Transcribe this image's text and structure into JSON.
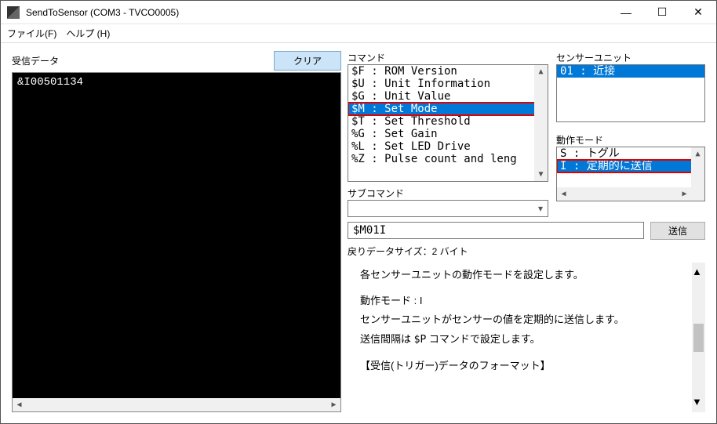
{
  "window": {
    "title": "SendToSensor (COM3 - TVCO0005)"
  },
  "menu": {
    "file": "ファイル(F)",
    "help": "ヘルプ (H)"
  },
  "left": {
    "label": "受信データ",
    "clear": "クリア",
    "console_line": "&I00501134"
  },
  "command": {
    "label": "コマンド",
    "items": [
      "$F : ROM Version",
      "$U : Unit Information",
      "$G : Unit Value",
      "$M : Set Mode",
      "$T : Set Threshold",
      "%G : Set Gain",
      "%L : Set LED Drive",
      "%Z : Pulse count and leng"
    ],
    "selected_index": 3
  },
  "sensor_unit": {
    "label": "センサーユニット",
    "item": "01 : 近接"
  },
  "mode": {
    "label": "動作モード",
    "items": [
      "S : トグル",
      "I : 定期的に送信"
    ],
    "selected_index": 1
  },
  "subcommand": {
    "label": "サブコマンド",
    "value": ""
  },
  "send": {
    "value": "$M01I",
    "button": "送信"
  },
  "return_size": "戻りデータサイズ：2 バイト",
  "desc": {
    "l1": "各センサーユニットの動作モードを設定します。",
    "l2": "動作モード : I",
    "l3": "センサーユニットがセンサーの値を定期的に送信します。",
    "l4": "送信間隔は $P コマンドで設定します。",
    "l5": "【受信(トリガー)データのフォーマット】"
  }
}
